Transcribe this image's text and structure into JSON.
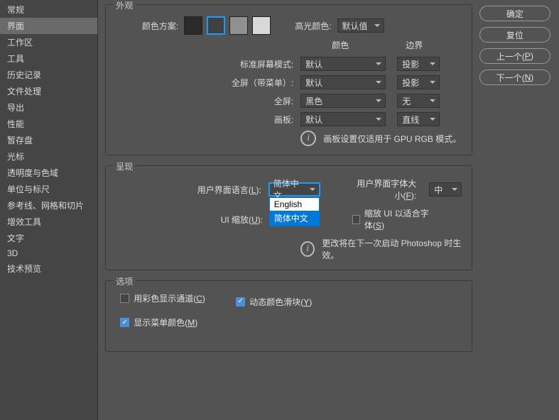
{
  "sidebar": {
    "items": [
      {
        "label": "常规"
      },
      {
        "label": "界面"
      },
      {
        "label": "工作区"
      },
      {
        "label": "工具"
      },
      {
        "label": "历史记录"
      },
      {
        "label": "文件处理"
      },
      {
        "label": "导出"
      },
      {
        "label": "性能"
      },
      {
        "label": "暂存盘"
      },
      {
        "label": "光标"
      },
      {
        "label": "透明度与色域"
      },
      {
        "label": "单位与标尺"
      },
      {
        "label": "参考线、网格和切片"
      },
      {
        "label": "增效工具"
      },
      {
        "label": "文字"
      },
      {
        "label": "3D"
      },
      {
        "label": "技术预览"
      }
    ],
    "selected_index": 1
  },
  "buttons": {
    "ok": "确定",
    "reset": "复位",
    "prev_pre": "上一个(",
    "prev_key": "P",
    "prev_post": ")",
    "next_pre": "下一个(",
    "next_key": "N",
    "next_post": ")"
  },
  "appearance": {
    "title": "外观",
    "color_scheme_label": "颜色方案:",
    "swatches": [
      "#2b2b2b",
      "#404040",
      "#909090",
      "#d8d8d8"
    ],
    "selected_swatch": 1,
    "highlight_label": "高光颜色:",
    "highlight_value": "默认值",
    "col_color": "颜色",
    "col_border": "边界",
    "rows": [
      {
        "label": "标准屏幕模式:",
        "color": "默认",
        "border": "投影"
      },
      {
        "label": "全屏（带菜单）:",
        "color": "默认",
        "border": "投影"
      },
      {
        "label": "全屏:",
        "color": "黑色",
        "border": "无"
      },
      {
        "label": "画板:",
        "color": "默认",
        "border": "直线"
      }
    ],
    "info": "画板设置仅适用于 GPU RGB 模式。"
  },
  "presentation": {
    "title": "呈现",
    "lang_pre": "用户界面语言(",
    "lang_key": "L",
    "lang_post": "):",
    "lang_value": "简体中文",
    "lang_options": [
      "English",
      "简体中文"
    ],
    "lang_highlight_index": 1,
    "fontsize_pre": "用户界面字体大小(",
    "fontsize_key": "F",
    "fontsize_post": "):",
    "fontsize_value": "中",
    "scale_pre": "UI 缩放(",
    "scale_key": "U",
    "scale_post": "):",
    "scaleui_pre": "缩放 UI 以适合字体(",
    "scaleui_key": "S",
    "scaleui_post": ")",
    "info": "更改将在下一次启动 Photoshop 时生效。"
  },
  "options": {
    "title": "选项",
    "color_channels_pre": "用彩色显示通道(",
    "color_channels_key": "C",
    "color_channels_post": ")",
    "color_channels_checked": false,
    "dynamic_sliders_pre": "动态颜色滑块(",
    "dynamic_sliders_key": "Y",
    "dynamic_sliders_post": ")",
    "dynamic_sliders_checked": true,
    "menu_colors_pre": "显示菜单颜色(",
    "menu_colors_key": "M",
    "menu_colors_post": ")",
    "menu_colors_checked": true
  }
}
